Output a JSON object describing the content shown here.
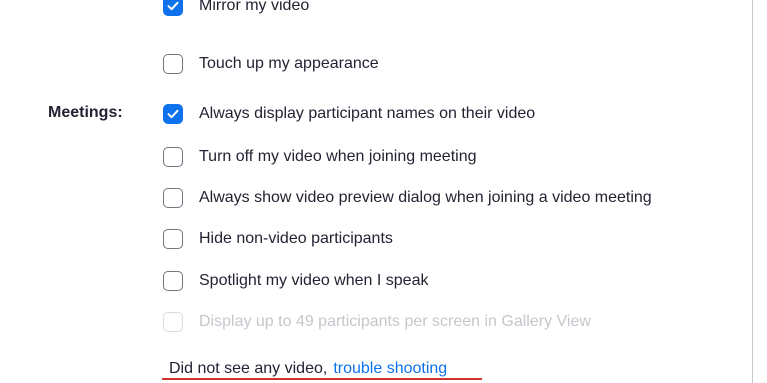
{
  "video_settings": {
    "mirror_option": {
      "label": "Mirror my video",
      "checked": true
    },
    "touchup_option": {
      "label": "Touch up my appearance",
      "checked": false
    }
  },
  "meetings": {
    "section_label": "Meetings:",
    "options": [
      {
        "label": "Always display participant names on their video",
        "checked": true,
        "disabled": false
      },
      {
        "label": "Turn off my video when joining meeting",
        "checked": false,
        "disabled": false
      },
      {
        "label": "Always show video preview dialog when joining a video meeting",
        "checked": false,
        "disabled": false
      },
      {
        "label": "Hide non-video participants",
        "checked": false,
        "disabled": false
      },
      {
        "label": "Spotlight my video when I speak",
        "checked": false,
        "disabled": false
      },
      {
        "label": "Display up to 49 participants per screen in Gallery View",
        "checked": false,
        "disabled": true
      }
    ]
  },
  "troubleshoot": {
    "text": "Did not see any video,",
    "link_label": "trouble shooting"
  },
  "colors": {
    "accent": "#0e72ed",
    "annotation_underline": "#d0342c"
  }
}
